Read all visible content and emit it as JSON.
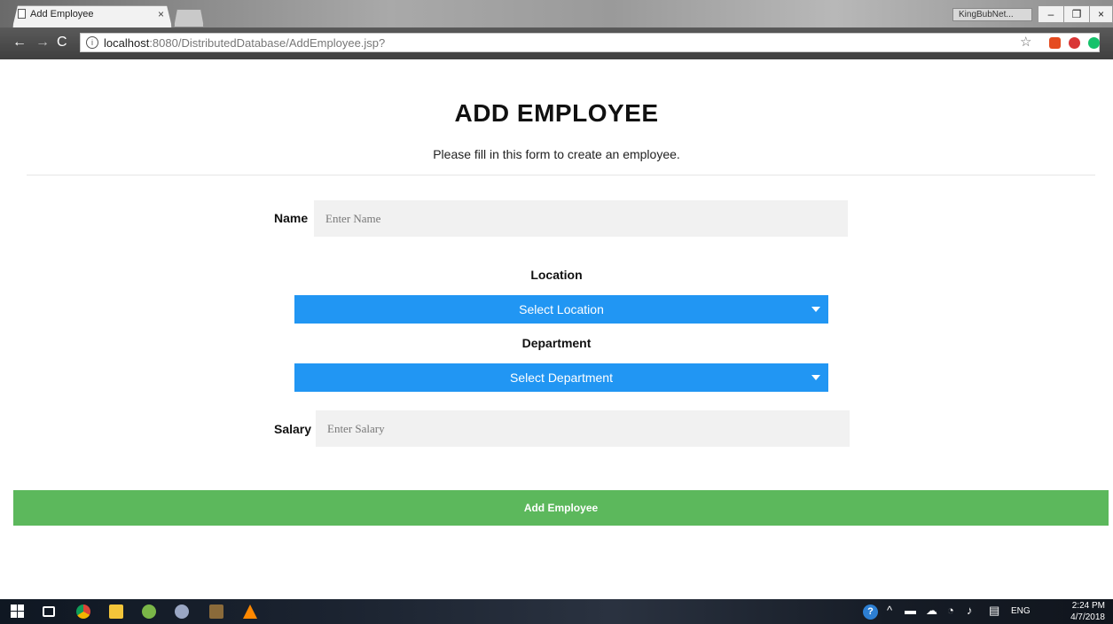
{
  "browser": {
    "tab_title": "Add Employee",
    "tab_close": "×",
    "profile_name": "KingBubNet...",
    "window_min": "–",
    "window_max": "❐",
    "window_close": "×",
    "url_host": "localhost",
    "url_path": ":8080/DistributedDatabase/AddEmployee.jsp?",
    "back_icon": "←",
    "forward_icon": "→",
    "reload_icon": "C",
    "info_icon": "i",
    "star_icon": "☆",
    "menu_icon": "⋮"
  },
  "form": {
    "title": "ADD EMPLOYEE",
    "subtitle": "Please fill in this form to create an employee.",
    "name_label": "Name",
    "name_placeholder": "Enter Name",
    "location_label": "Location",
    "location_select": "Select Location",
    "department_label": "Department",
    "department_select": "Select Department",
    "salary_label": "Salary",
    "salary_placeholder": "Enter Salary",
    "submit_label": "Add Employee"
  },
  "colors": {
    "select_accent": "#2196f3",
    "submit_green": "#5cb85c",
    "input_bg": "#f1f1f1"
  },
  "taskbar": {
    "language": "ENG",
    "time": "2:24 PM",
    "date": "4/7/2018",
    "tray_up": "^",
    "help": "?"
  }
}
